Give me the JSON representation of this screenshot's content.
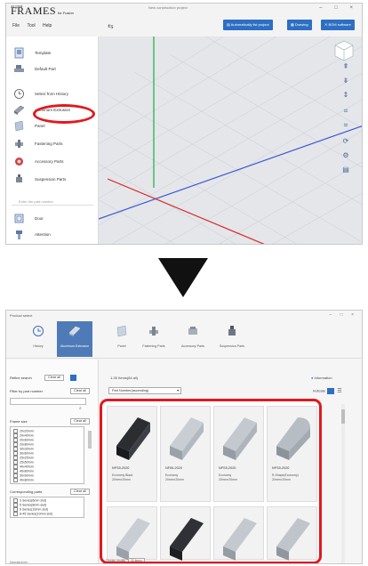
{
  "top_window": {
    "logo_super": "ALUMI",
    "logo": "FRAMES",
    "logo_suffix": "for Fusion",
    "title": "New construction project",
    "window_controls": "– □ ×",
    "menu": [
      "File",
      "Tool",
      "Help"
    ],
    "toolbar": {
      "button_1": "Automatically list project",
      "button_2": "Drawing",
      "button_3": "BOM software"
    },
    "left_panel": {
      "items": [
        {
          "label": "Template",
          "icon": "template-icon"
        },
        {
          "label": "Default Part",
          "icon": "default-part-icon"
        },
        {
          "label": "Select from History",
          "icon": "history-icon"
        },
        {
          "label": "Aluminum Extrusion",
          "icon": "aluminum-extrusion-icon"
        },
        {
          "label": "Panel",
          "icon": "panel-icon"
        },
        {
          "label": "Fastening Parts",
          "icon": "fastening-parts-icon"
        },
        {
          "label": "Accessory Parts",
          "icon": "accessory-parts-icon"
        },
        {
          "label": "Suspension Parts",
          "icon": "suspension-parts-icon"
        },
        {
          "label": "Door",
          "icon": "door-icon"
        },
        {
          "label": "Attention",
          "icon": "attention-icon"
        }
      ],
      "search_placeholder": "Enter the part number"
    }
  },
  "bottom_window": {
    "title": "Product select",
    "window_controls": "– □ ×",
    "categories": [
      {
        "label": "History",
        "icon": "history-icon",
        "active": false
      },
      {
        "label": "Aluminum Extrusion",
        "icon": "aluminum-extrusion-icon",
        "active": true
      },
      {
        "label": "Panel",
        "icon": "panel-icon",
        "active": false
      },
      {
        "label": "Fastening Parts",
        "icon": "fastening-parts-icon",
        "active": false
      },
      {
        "label": "Accessory Parts",
        "icon": "accessory-parts-icon",
        "active": false
      },
      {
        "label": "Suspension Parts",
        "icon": "suspension-parts-icon",
        "active": false
      }
    ],
    "filter": {
      "refine_label": "Refine search",
      "clear_all": "Clear all",
      "part_number_label": "Filter by part number",
      "frame_size_label": "Frame size",
      "frame_sizes": [
        "20x20mm",
        "20x40mm",
        "20x60mm",
        "20x80mm",
        "30x30mm",
        "30x60mm",
        "25x25mm",
        "25x50mm",
        "40x40mm",
        "40x80mm",
        "30x90mm",
        "40x80mm"
      ],
      "corresponding_label": "Corresponding parts",
      "corresponding": [
        "3 Series(6mm slot)",
        "5 Series(8mm slot)",
        "6 Series(10mm slot)",
        "8-45 Series(10mm slot)"
      ],
      "footer_left": "Manufacturer"
    },
    "results": {
      "count": "1-30 Items(84 all)",
      "info_label": "Information",
      "sort": "Part Number(ascending)",
      "view_label": "Indicate",
      "products": [
        {
          "name": "NFS5-2020",
          "desc": "Economy Black\n20mm×20mm"
        },
        {
          "name": "NF06-2020",
          "desc": "Economy\n20mm×20mm"
        },
        {
          "name": "NFS5-2020",
          "desc": "Economy\n20mm×20mm"
        },
        {
          "name": "NFS5-2020",
          "desc": "R-Shape(Economy)\n20mm×20mm"
        }
      ],
      "pager": "Display results",
      "pager_select": "30 items"
    }
  },
  "colors": {
    "accent_blue": "#2d6fc2",
    "highlight_red": "#e0191f",
    "active_category": "#4e7bb8"
  }
}
